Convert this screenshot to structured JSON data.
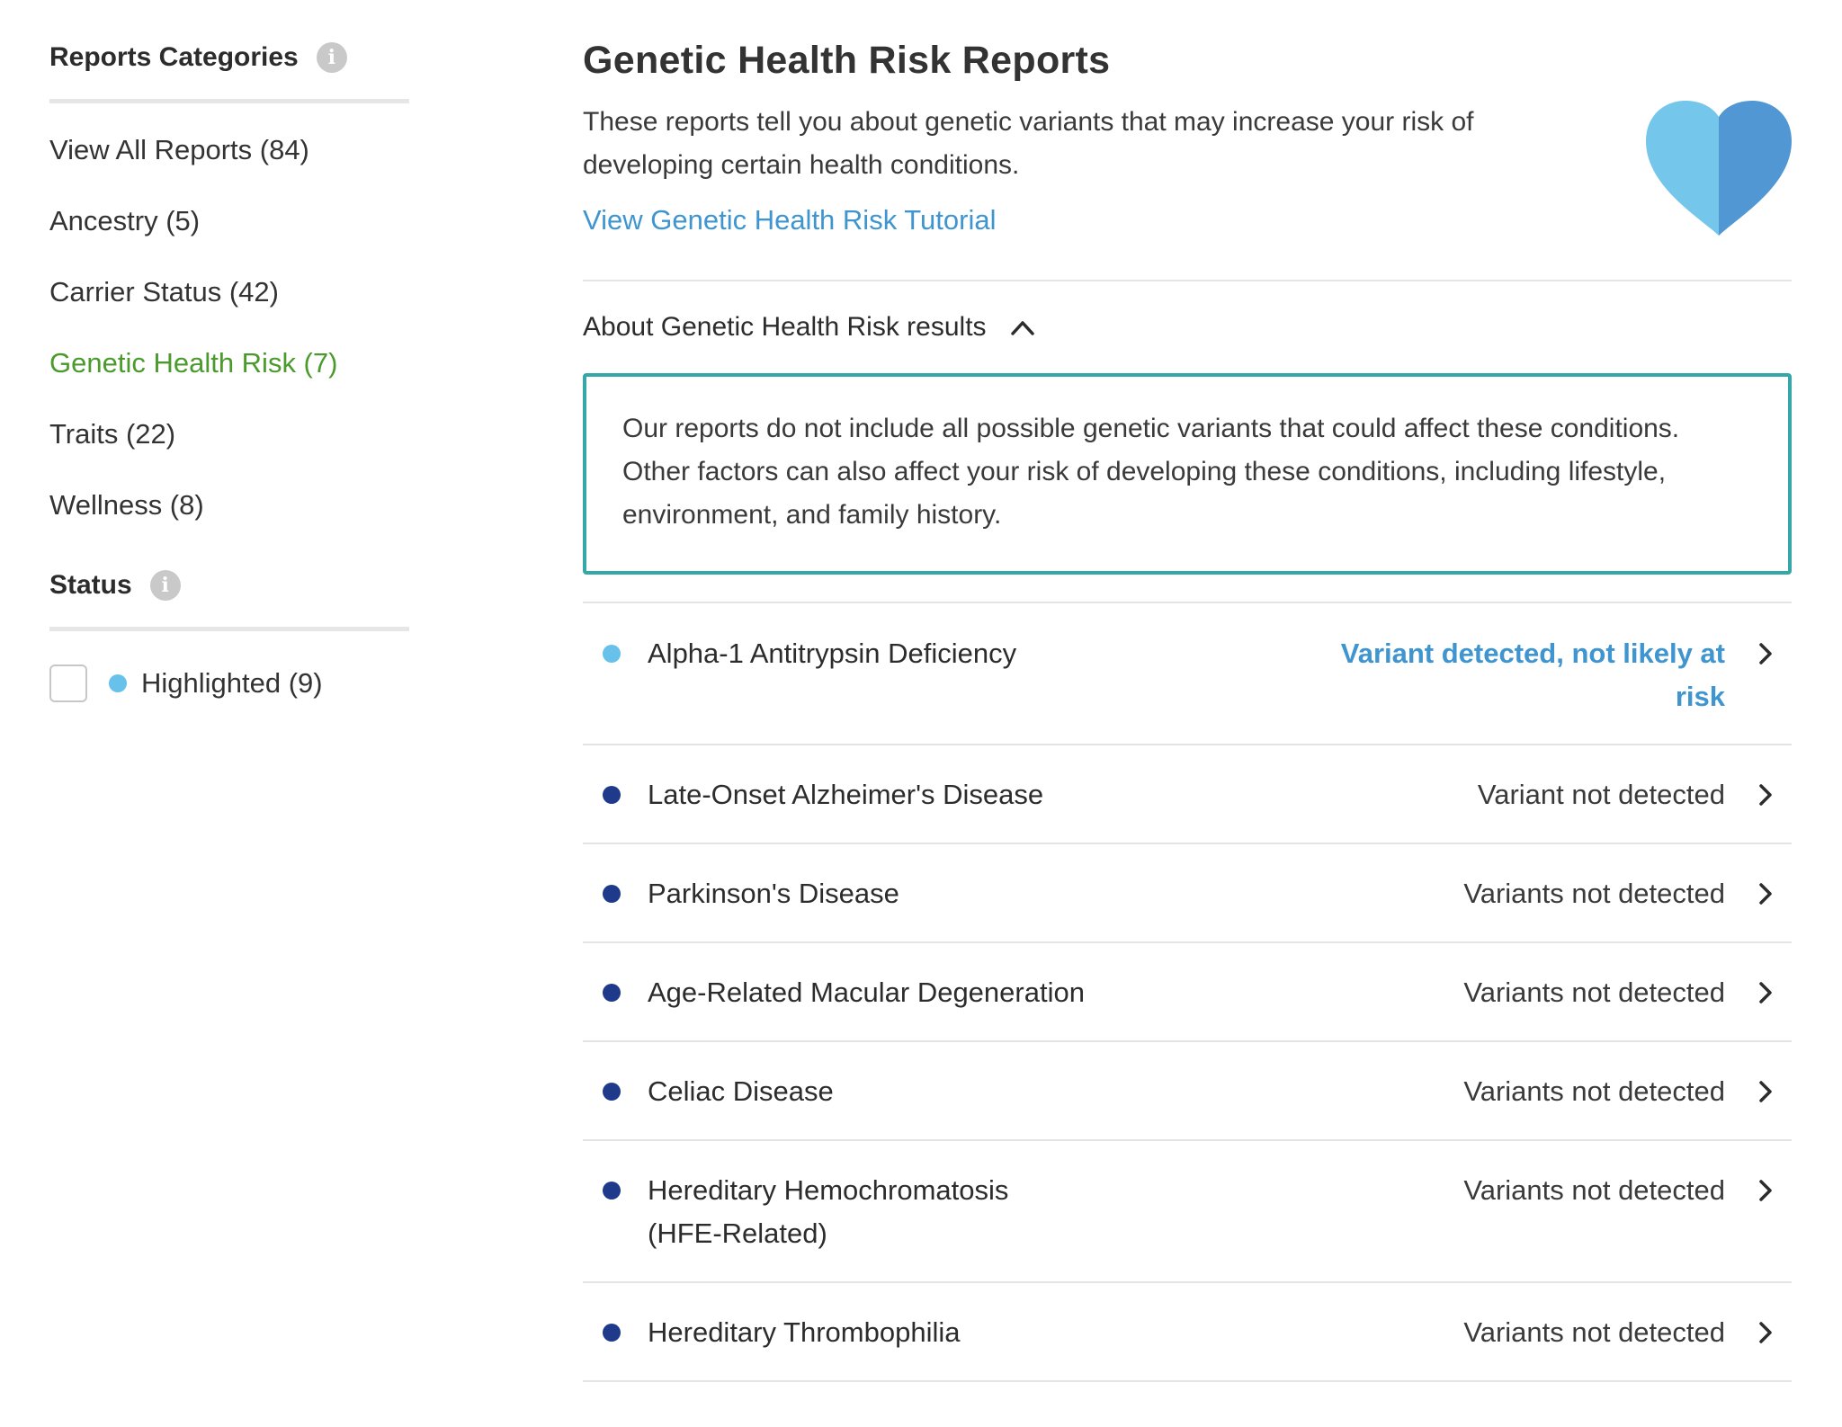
{
  "sidebar": {
    "categories_heading": "Reports Categories",
    "items": [
      {
        "label": "View All Reports (84)"
      },
      {
        "label": "Ancestry (5)"
      },
      {
        "label": "Carrier Status (42)"
      },
      {
        "label": "Genetic Health Risk (7)"
      },
      {
        "label": "Traits (22)"
      },
      {
        "label": "Wellness (8)"
      }
    ],
    "active_item": "Genetic Health Risk (7)",
    "status_heading": "Status",
    "filters": [
      {
        "label": "Highlighted (9)",
        "checked": false,
        "dot_color": "#67c1ea"
      }
    ],
    "info_icon": "info-icon"
  },
  "main": {
    "title": "Genetic Health Risk Reports",
    "intro": "These reports tell you about genetic variants that may increase your risk of developing certain health conditions.",
    "tutorial_link": "View Genetic Health Risk Tutorial",
    "hero_icon": "heart-icon",
    "about": {
      "label": "About Genetic Health Risk results",
      "expanded": true,
      "text": "Our reports do not include all possible genetic variants that could affect these conditions. Other factors can also affect your risk of developing these conditions, including lifestyle, environment, and family history."
    },
    "reports": [
      {
        "name": "Alpha-1 Antitrypsin Deficiency",
        "status": "Variant detected, not likely at risk",
        "highlighted": true
      },
      {
        "name": "Late-Onset Alzheimer's Disease",
        "status": "Variant not detected",
        "highlighted": false
      },
      {
        "name": "Parkinson's Disease",
        "status": "Variants not detected",
        "highlighted": false
      },
      {
        "name": "Age-Related Macular Degeneration",
        "status": "Variants not detected",
        "highlighted": false
      },
      {
        "name": "Celiac Disease",
        "status": "Variants not detected",
        "highlighted": false
      },
      {
        "name": "Hereditary Hemochromatosis (HFE-Related)",
        "status": "Variants not detected",
        "highlighted": false
      },
      {
        "name": "Hereditary Thrombophilia",
        "status": "Variants not detected",
        "highlighted": false
      }
    ]
  },
  "colors": {
    "active_green": "#4a9a2c",
    "link_blue": "#3f95d0",
    "highlight_dot": "#67c1ea",
    "normal_dot": "#1f3a8a",
    "callout_border": "#36a7a8",
    "heart_light": "#74c6ea",
    "heart_dark": "#5197d3"
  }
}
